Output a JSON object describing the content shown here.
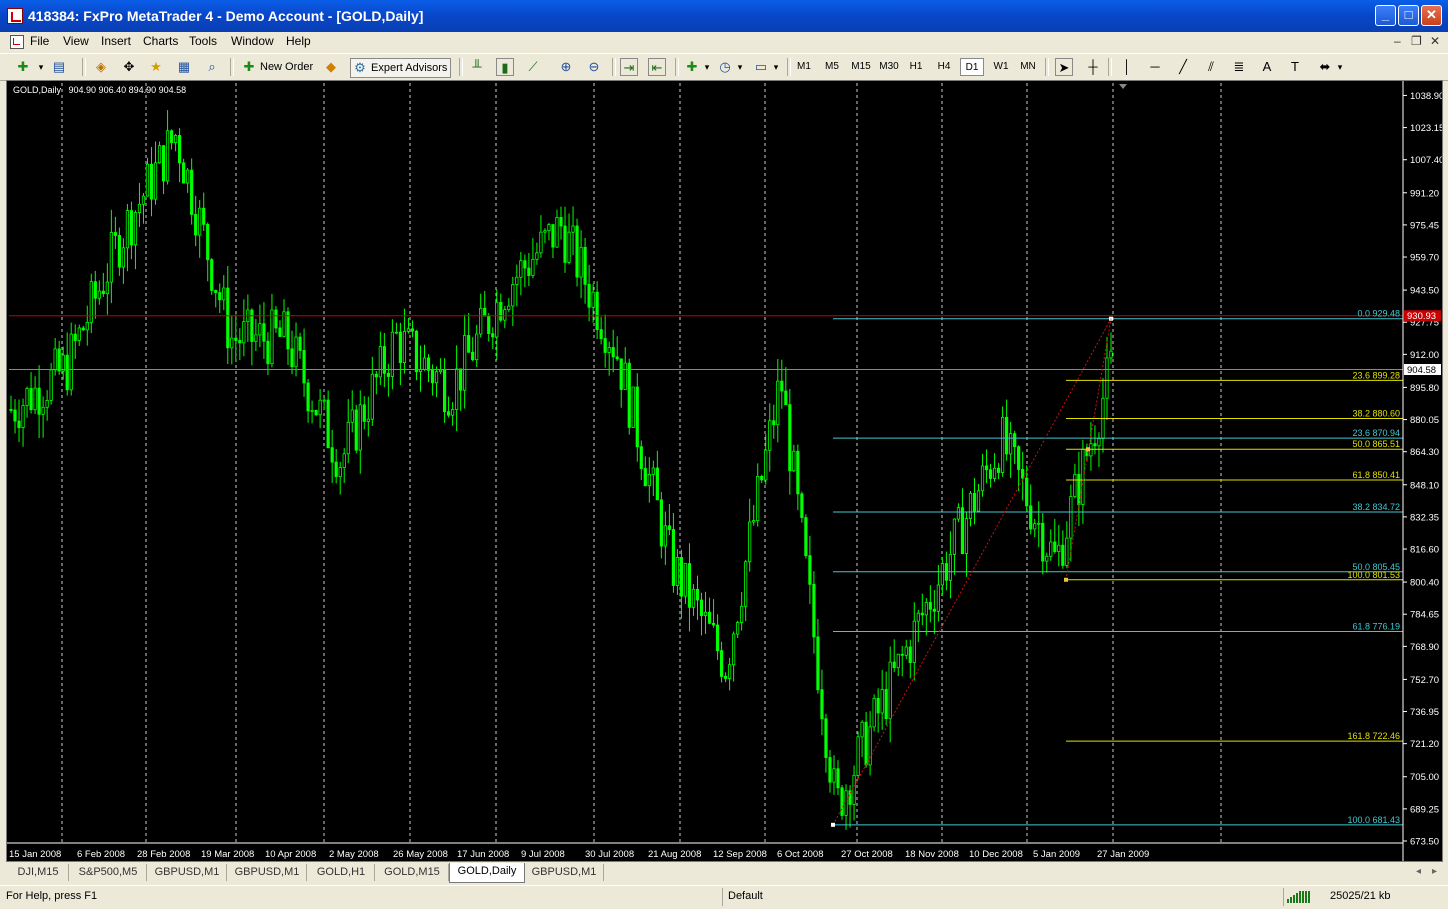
{
  "window": {
    "title": "418384: FxPro MetaTrader 4 - Demo Account - [GOLD,Daily]",
    "buttons": {
      "minimize": "_",
      "maximize": "□",
      "close": "✕"
    }
  },
  "menu": {
    "items": [
      "File",
      "View",
      "Insert",
      "Charts",
      "Tools",
      "Window",
      "Help"
    ],
    "mdi": {
      "minimize": "–",
      "restore": "❐",
      "close": "✕"
    }
  },
  "toolbar": {
    "new_order": "New Order",
    "expert_advisors": "Expert Advisors",
    "timeframes": [
      "M1",
      "M5",
      "M15",
      "M30",
      "H1",
      "H4",
      "D1",
      "W1",
      "MN"
    ],
    "active_timeframe": "D1"
  },
  "chart": {
    "symbol_label": "GOLD,Daily",
    "ohlc": "904.90 906.40 894.90 904.58"
  },
  "chart_data": {
    "type": "candlestick",
    "symbol": "GOLD",
    "timeframe": "Daily",
    "ylim": [
      673.5,
      1045.0
    ],
    "y_ticks": [
      "1038.90",
      "1023.15",
      "1007.40",
      "991.20",
      "975.45",
      "959.70",
      "943.50",
      "927.75",
      "912.00",
      "895.80",
      "880.05",
      "864.30",
      "848.10",
      "832.35",
      "816.60",
      "800.40",
      "784.65",
      "768.90",
      "752.70",
      "736.95",
      "721.20",
      "705.00",
      "689.25",
      "673.50"
    ],
    "x_ticks": [
      "15 Jan 2008",
      "6 Feb 2008",
      "28 Feb 2008",
      "19 Mar 2008",
      "10 Apr 2008",
      "2 May 2008",
      "26 May 2008",
      "17 Jun 2008",
      "9 Jul 2008",
      "30 Jul 2008",
      "21 Aug 2008",
      "12 Sep 2008",
      "6 Oct 2008",
      "27 Oct 2008",
      "18 Nov 2008",
      "10 Dec 2008",
      "5 Jan 2009",
      "27 Jan 2009"
    ],
    "approx_close_path": [
      {
        "date": "15 Jan 2008",
        "close": 885
      },
      {
        "date": "6 Feb 2008",
        "close": 905
      },
      {
        "date": "28 Feb 2008",
        "close": 970
      },
      {
        "date": "6 Mar 2008",
        "close": 1020
      },
      {
        "date": "19 Mar 2008",
        "close": 920
      },
      {
        "date": "10 Apr 2008",
        "close": 920
      },
      {
        "date": "2 May 2008",
        "close": 860
      },
      {
        "date": "26 May 2008",
        "close": 920
      },
      {
        "date": "17 Jun 2008",
        "close": 895
      },
      {
        "date": "9 Jul 2008",
        "close": 945
      },
      {
        "date": "14 Jul 2008",
        "close": 975
      },
      {
        "date": "30 Jul 2008",
        "close": 915
      },
      {
        "date": "21 Aug 2008",
        "close": 810
      },
      {
        "date": "12 Sep 2008",
        "close": 760
      },
      {
        "date": "6 Oct 2008",
        "close": 900
      },
      {
        "date": "24 Oct 2008",
        "close": 690
      },
      {
        "date": "18 Nov 2008",
        "close": 750
      },
      {
        "date": "10 Dec 2008",
        "close": 810
      },
      {
        "date": "30 Dec 2008",
        "close": 870
      },
      {
        "date": "15 Jan 2009",
        "close": 810
      },
      {
        "date": "27 Jan 2009",
        "close": 905
      }
    ],
    "horizontal_lines": [
      {
        "value": 930.93,
        "color": "#c80000",
        "label": "930.93"
      },
      {
        "value": 904.58,
        "color": "#7a8aa0",
        "label": "904.58"
      }
    ],
    "fibo_cyan": {
      "color": "#40c8d0",
      "levels": [
        {
          "label": "0.0",
          "value": 929.48
        },
        {
          "label": "23.6",
          "value": 870.94
        },
        {
          "label": "38.2",
          "value": 834.72
        },
        {
          "label": "50.0",
          "value": 805.45
        },
        {
          "label": "61.8",
          "value": 776.19
        },
        {
          "label": "100.0",
          "value": 681.43
        }
      ]
    },
    "fibo_yellow": {
      "color": "#e0e000",
      "levels": [
        {
          "label": "23.6",
          "value": 899.28
        },
        {
          "label": "38.2",
          "value": 880.6
        },
        {
          "label": "50.0",
          "value": 865.51
        },
        {
          "label": "61.8",
          "value": 850.41
        },
        {
          "label": "100.0",
          "value": 801.53
        },
        {
          "label": "161.8",
          "value": 722.46
        }
      ]
    }
  },
  "tabs": {
    "items": [
      "DJI,M15",
      "S&P500,M5",
      "GBPUSD,M1",
      "GBPUSD,M1",
      "GOLD,H1",
      "GOLD,M15",
      "GOLD,Daily",
      "GBPUSD,M1"
    ],
    "active_index": 6
  },
  "status": {
    "help": "For Help, press F1",
    "profile": "Default",
    "traffic": "25025/21 kb"
  },
  "colors": {
    "candle": "#00ff00",
    "background": "#000000",
    "grid": "#ffffff",
    "axis_text": "#ffffff",
    "current_price_label_bg": "#ffffff",
    "high_label_bg": "#c80000"
  }
}
